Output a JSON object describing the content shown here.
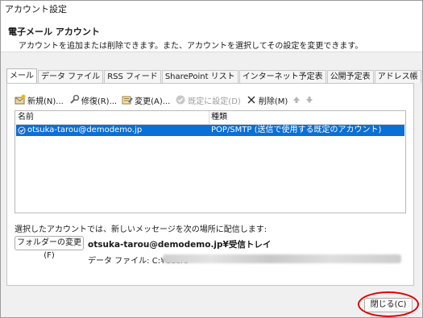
{
  "window": {
    "title": "アカウント設定"
  },
  "header": {
    "title": "電子メール アカウント",
    "description": "アカウントを追加または削除できます。また、アカウントを選択してその設定を変更できます。"
  },
  "tabs": [
    {
      "label": "メール",
      "active": true
    },
    {
      "label": "データ ファイル"
    },
    {
      "label": "RSS フィード"
    },
    {
      "label": "SharePoint リスト"
    },
    {
      "label": "インターネット予定表"
    },
    {
      "label": "公開予定表"
    },
    {
      "label": "アドレス帳"
    }
  ],
  "toolbar": {
    "new_label": "新規(N)...",
    "repair_label": "修復(R)...",
    "change_label": "変更(A)...",
    "default_label": "既定に設定(D)",
    "delete_label": "削除(M)",
    "move_up_icon": "arrow-up-icon",
    "move_down_icon": "arrow-down-icon"
  },
  "account_list": {
    "columns": [
      "名前",
      "種類"
    ],
    "rows": [
      {
        "name": "otsuka-tarou@demodemo.jp",
        "type": "POP/SMTP (送信で使用する既定のアカウント)",
        "selected": true
      }
    ]
  },
  "delivery": {
    "label": "選択したアカウントでは、新しいメッセージを次の場所に配信します:",
    "folder_button": "フォルダーの変更(F)",
    "path": "otsuka-tarou@demodemo.jp¥受信トレイ",
    "data_file_label": "データ ファイル: C:¥Users"
  },
  "footer": {
    "close_label": "閉じる(C)"
  },
  "colors": {
    "selection": "#0a6fd6",
    "highlight": "#e60000"
  }
}
